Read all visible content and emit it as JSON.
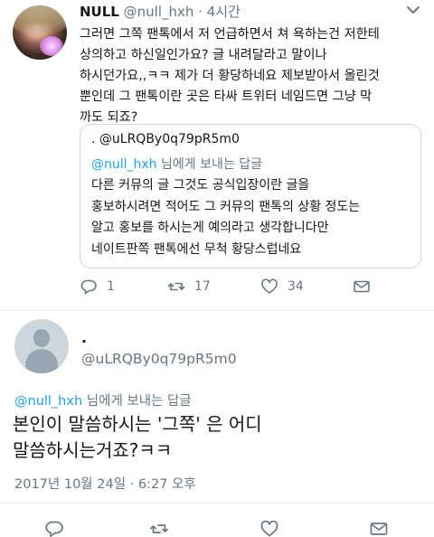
{
  "tweet": {
    "author_name": "NULL",
    "author_handle": "@null_hxh",
    "separator": "·",
    "time": "4시간",
    "text": "그러면 그쪽 팬톡에서 저 언급하면서 쳐 욕하는건 저한테\n상의하고 하신일인가요? 글 내려달라고 말이나\n하시던가요,,ㅋㅋ 제가 더 황당하네요 제보받아서 올린것\n뿐인데 그 팬톡이란 곳은 타싸 트위터 네임드면 그냥 막\n까도 되죠?",
    "quote": {
      "name": ".",
      "handle": "@uLRQBy0q79pR5m0",
      "reply_to_handle": "@null_hxh",
      "reply_to_suffix": " 님에게 보내는 답글",
      "text": "다른 커뮤의 글 그것도 공식입장이란 글을\n홍보하시려면 적어도 그 커뮤의 팬톡의 상황 정도는\n알고 홍보를 하시는게 예의라고 생각합니다만\n네이트판쪽 팬톡에선 무척 황당스럽네요"
    },
    "stats": {
      "replies": "1",
      "retweets": "17",
      "likes": "34"
    },
    "icons": [
      "chevron-down-icon",
      "reply-icon",
      "retweet-icon",
      "like-icon",
      "message-icon"
    ]
  },
  "reply": {
    "author_name": ".",
    "author_handle": "@uLRQBy0q79pR5m0",
    "reply_to_handle": "@null_hxh",
    "reply_to_suffix": " 님에게 보내는 답글",
    "text": "본인이 말씀하시는 '그쪽' 은 어디\n말씀하시는거죠?ㅋㅋ",
    "date": "2017년 10월 24일 · 6:27 오후",
    "icons": [
      "reply-icon",
      "retweet-icon",
      "like-icon",
      "message-icon"
    ]
  },
  "colors": {
    "link": "#1da1f2",
    "secondary_text": "#657786",
    "primary_text": "#14171a",
    "border": "#ccd6dd"
  }
}
